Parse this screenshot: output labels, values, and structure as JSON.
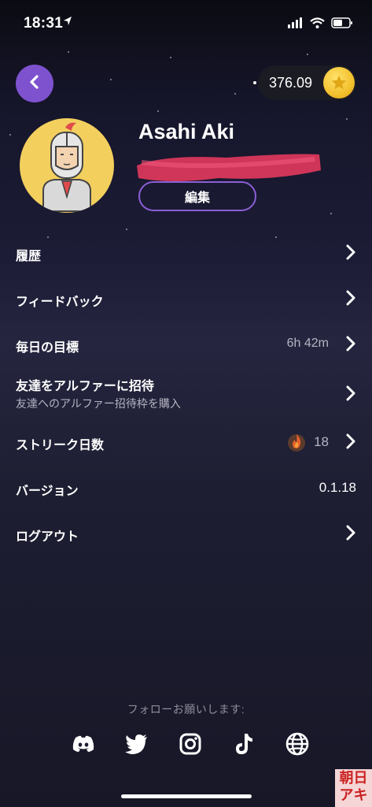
{
  "status_bar": {
    "time": "18:31"
  },
  "header": {
    "coin_balance": "376.09"
  },
  "profile": {
    "name": "Asahi Aki",
    "edit_label": "編集"
  },
  "menu": {
    "history": "履歴",
    "feedback": "フィードバック",
    "daily_goal": {
      "label": "毎日の目標",
      "value": "6h 42m"
    },
    "invite": {
      "label": "友達をアルファーに招待",
      "sub": "友達へのアルファー招待枠を購入"
    },
    "streak": {
      "label": "ストリーク日数",
      "value": "18"
    },
    "version": {
      "label": "バージョン",
      "value": "0.1.18"
    },
    "logout": "ログアウト"
  },
  "footer": {
    "follow_label": "フォローお願いします:",
    "socials": [
      "discord-icon",
      "twitter-icon",
      "instagram-icon",
      "tiktok-icon",
      "globe-icon"
    ]
  },
  "watermark": {
    "line1": "朝日",
    "line2": "アキ"
  },
  "colors": {
    "accent": "#7e52cf",
    "coin": "#f2c12e",
    "flame": "#e8612c"
  }
}
